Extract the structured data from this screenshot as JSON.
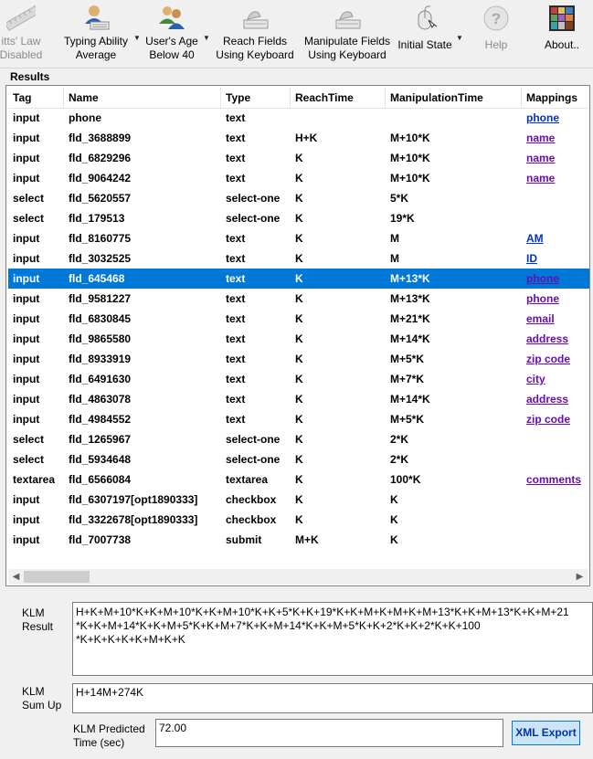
{
  "toolbar": {
    "fitts": {
      "line1": "itts' Law",
      "line2": "Disabled"
    },
    "typing": {
      "line1": "Typing Ability",
      "line2": "Average"
    },
    "age": {
      "line1": "User's Age",
      "line2": "Below 40"
    },
    "reach": {
      "line1": "Reach Fields",
      "line2": "Using Keyboard"
    },
    "manip": {
      "line1": "Manipulate Fields",
      "line2": "Using Keyboard"
    },
    "initial": {
      "line1": "Initial State"
    },
    "help": {
      "line1": "Help"
    },
    "about": {
      "line1": "About.."
    }
  },
  "results": {
    "label": "Results",
    "columns": [
      "Tag",
      "Name",
      "Type",
      "ReachTime",
      "ManipulationTime",
      "Mappings"
    ],
    "rows": [
      {
        "tag": "input",
        "name": "phone",
        "type": "text",
        "reach": "",
        "manip": "",
        "map": "phone",
        "selected": false
      },
      {
        "tag": "input",
        "name": "fld_3688899",
        "type": "text",
        "reach": "H+K",
        "manip": "M+10*K",
        "map": "name",
        "selected": false
      },
      {
        "tag": "input",
        "name": "fld_6829296",
        "type": "text",
        "reach": "K",
        "manip": "M+10*K",
        "map": "name",
        "selected": false
      },
      {
        "tag": "input",
        "name": "fld_9064242",
        "type": "text",
        "reach": "K",
        "manip": "M+10*K",
        "map": "name",
        "selected": false
      },
      {
        "tag": "select",
        "name": "fld_5620557",
        "type": "select-one",
        "reach": "K",
        "manip": "5*K",
        "map": "",
        "selected": false
      },
      {
        "tag": "select",
        "name": "fld_179513",
        "type": "select-one",
        "reach": "K",
        "manip": "19*K",
        "map": "",
        "selected": false
      },
      {
        "tag": "input",
        "name": "fld_8160775",
        "type": "text",
        "reach": "K",
        "manip": "M",
        "map": "AM",
        "selected": false
      },
      {
        "tag": "input",
        "name": "fld_3032525",
        "type": "text",
        "reach": "K",
        "manip": "M",
        "map": "ID",
        "selected": false
      },
      {
        "tag": "input",
        "name": "fld_645468",
        "type": "text",
        "reach": "K",
        "manip": "M+13*K",
        "map": "phone",
        "selected": true
      },
      {
        "tag": "input",
        "name": "fld_9581227",
        "type": "text",
        "reach": "K",
        "manip": "M+13*K",
        "map": "phone",
        "selected": false
      },
      {
        "tag": "input",
        "name": "fld_6830845",
        "type": "text",
        "reach": "K",
        "manip": "M+21*K",
        "map": "email",
        "selected": false
      },
      {
        "tag": "input",
        "name": "fld_9865580",
        "type": "text",
        "reach": "K",
        "manip": "M+14*K",
        "map": "address",
        "selected": false
      },
      {
        "tag": "input",
        "name": "fld_8933919",
        "type": "text",
        "reach": "K",
        "manip": "M+5*K",
        "map": "zip code",
        "selected": false
      },
      {
        "tag": "input",
        "name": "fld_6491630",
        "type": "text",
        "reach": "K",
        "manip": "M+7*K",
        "map": "city",
        "selected": false
      },
      {
        "tag": "input",
        "name": "fld_4863078",
        "type": "text",
        "reach": "K",
        "manip": "M+14*K",
        "map": "address",
        "selected": false
      },
      {
        "tag": "input",
        "name": "fld_4984552",
        "type": "text",
        "reach": "K",
        "manip": "M+5*K",
        "map": "zip code",
        "selected": false
      },
      {
        "tag": "select",
        "name": "fld_1265967",
        "type": "select-one",
        "reach": "K",
        "manip": "2*K",
        "map": "",
        "selected": false
      },
      {
        "tag": "select",
        "name": "fld_5934648",
        "type": "select-one",
        "reach": "K",
        "manip": "2*K",
        "map": "",
        "selected": false
      },
      {
        "tag": "textarea",
        "name": "fld_6566084",
        "type": "textarea",
        "reach": "K",
        "manip": "100*K",
        "map": "comments",
        "selected": false
      },
      {
        "tag": "input",
        "name": "fld_6307197[opt1890333]",
        "type": "checkbox",
        "reach": "K",
        "manip": "K",
        "map": "",
        "selected": false
      },
      {
        "tag": "input",
        "name": "fld_3322678[opt1890333]",
        "type": "checkbox",
        "reach": "K",
        "manip": "K",
        "map": "",
        "selected": false
      },
      {
        "tag": "input",
        "name": "fld_7007738",
        "type": "submit",
        "reach": "M+K",
        "manip": "K",
        "map": "",
        "selected": false
      }
    ]
  },
  "klm": {
    "result_label1": "KLM",
    "result_label2": "Result",
    "result_lines": [
      "H+K+M+10*K+K+M+10*K+K+M+10*K+K+5*K+K+19*K+K+M+K+M+K+M+13*K+K+M+13*K+K+M+21",
      "*K+K+M+14*K+K+M+5*K+K+M+7*K+K+M+14*K+K+M+5*K+K+2*K+K+2*K+K+100",
      "*K+K+K+K+K+M+K+K"
    ],
    "sum_label1": "KLM",
    "sum_label2": "Sum Up",
    "sum_value": "H+14M+274K",
    "pred_label1": "KLM Predicted",
    "pred_label2": "Time (sec)",
    "pred_value": "72.00",
    "export_label": "XML Export"
  }
}
